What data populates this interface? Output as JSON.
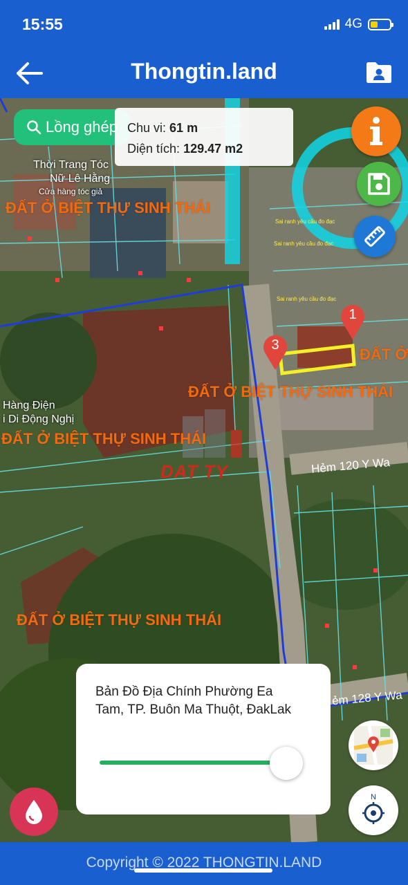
{
  "status_bar": {
    "time": "15:55",
    "network": "4G"
  },
  "header": {
    "title": "Thongtin.land"
  },
  "map": {
    "search_label": "Lồng ghép",
    "measure": {
      "perimeter_label": "Chu vi:",
      "perimeter_value": "61 m",
      "area_label": "Diện tích:",
      "area_value": "129.47 m2"
    },
    "markers": [
      "1",
      "3"
    ],
    "zones": [
      "ĐẤT Ở BIỆT THỰ SINH THÁI",
      "ĐẤT Ở BIỆT THỰ SINH THÁI",
      "ĐẤT Ở BIỆT THỰ SINH THÁI",
      "ĐẤT Ở BIỆT THỰ SINH THÁI",
      "ĐẤT Ở"
    ],
    "streets": [
      "Hẻm 120 Y Wa",
      "ẻm 128 Y Wa"
    ],
    "pois": [
      "Thời Trang Tóc",
      "Nữ Lê Hằng",
      "Cửa hàng tóc giả",
      "Hàng Điện",
      "i Di Động Nghị"
    ],
    "notes": [
      "Sai ranh yêu cầu đo đạc",
      "Sai ranh yêu cầu đo đạc",
      "Sai ranh yêu cầu đo đạc"
    ],
    "watermark": "DAT TY"
  },
  "info_card": {
    "text": "Bản Đồ Địa Chính Phường Ea Tam, TP. Buôn Ma Thuột, ĐakLak",
    "opacity": 0.9
  },
  "footer": {
    "copyright": "Copyright © 2022 THONGTIN.LAND"
  },
  "colors": {
    "brand": "#1a5fd0",
    "zone_text": "#f26a10",
    "search": "#22c07a",
    "info": "#f47a18",
    "save": "#4db847",
    "measure": "#1f78d6",
    "drop": "#d83455"
  },
  "icons": [
    "back-arrow-icon",
    "folder-user-icon",
    "search-icon",
    "info-icon",
    "save-icon",
    "ruler-icon",
    "map-pin-icon",
    "water-drop-icon",
    "map-type-icon",
    "compass-icon"
  ]
}
